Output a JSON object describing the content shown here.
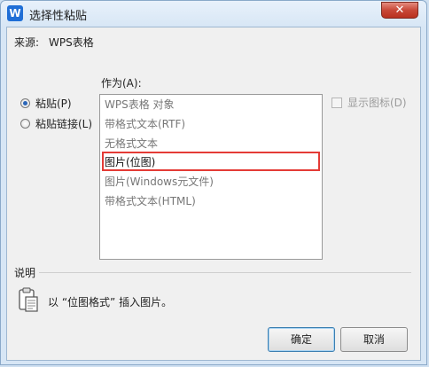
{
  "window": {
    "title": "选择性粘贴",
    "app_icon": "W",
    "close_label": "✕"
  },
  "source": {
    "label": "来源:",
    "value": "WPS表格"
  },
  "paste_options": [
    {
      "label": "粘贴(P)",
      "selected": true
    },
    {
      "label": "粘贴链接(L)",
      "selected": false
    }
  ],
  "as": {
    "label": "作为(A):",
    "items": [
      "WPS表格 对象",
      "带格式文本(RTF)",
      "无格式文本",
      "图片(位图)",
      "图片(Windows元文件)",
      "带格式文本(HTML)"
    ],
    "selected_index": 3
  },
  "show_icon": {
    "label": "显示图标(D)",
    "checked": false
  },
  "description": {
    "group_label": "说明",
    "text": "以 “位图格式” 插入图片。"
  },
  "buttons": {
    "ok": "确定",
    "cancel": "取消"
  }
}
